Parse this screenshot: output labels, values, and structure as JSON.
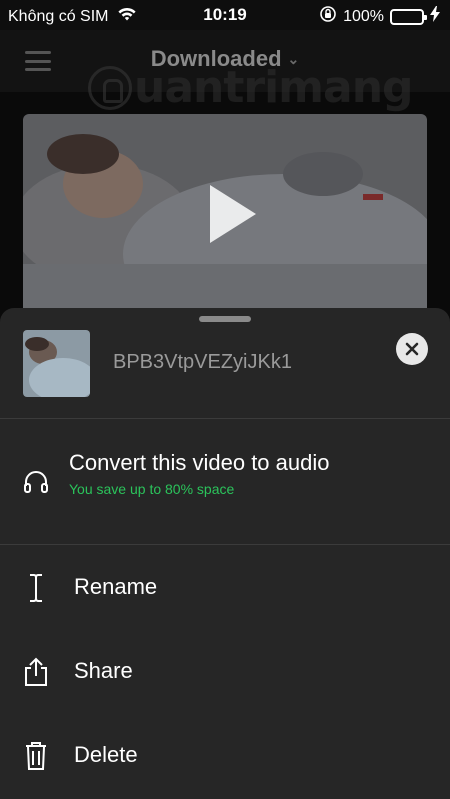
{
  "status_bar": {
    "carrier": "Không có SIM",
    "time": "10:19",
    "battery_percent_text": "100%",
    "battery_level": 1.0
  },
  "nav": {
    "title": "Downloaded"
  },
  "watermark": {
    "text": "uantrimang"
  },
  "sheet": {
    "filename": "BPB3VtpVEZyiJKk1",
    "convert": {
      "label": "Convert this video to audio",
      "sublabel": "You save up to 80% space"
    },
    "actions": [
      {
        "label": "Rename",
        "icon": "text-cursor-icon"
      },
      {
        "label": "Share",
        "icon": "share-icon"
      },
      {
        "label": "Delete",
        "icon": "trash-icon"
      }
    ]
  },
  "colors": {
    "accent_green": "#2bc35b",
    "battery_green": "#4cd964",
    "sheet_bg": "#262626"
  }
}
